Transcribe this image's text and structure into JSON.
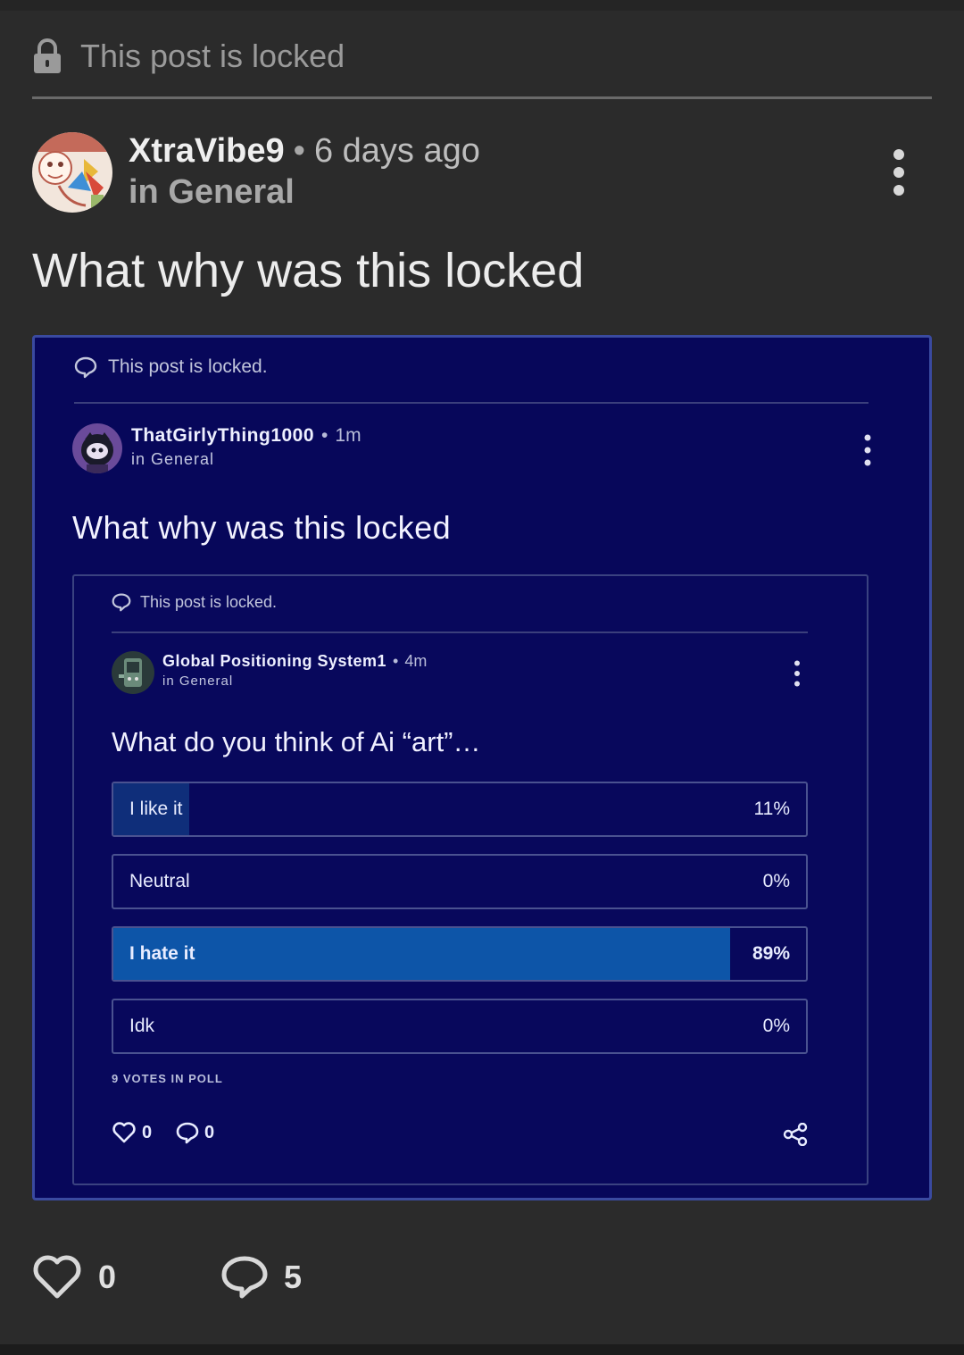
{
  "locked_notice": "This post is locked",
  "post": {
    "author": "XtraVibe9",
    "time": "6 days ago",
    "category": "in General",
    "title": "What why was this locked",
    "likes": "0",
    "comments": "5"
  },
  "embed": {
    "locked_notice": "This post is locked.",
    "author": "ThatGirlyThing1000",
    "time": "1m",
    "category": "in General",
    "title": "What why was this locked",
    "inner": {
      "locked_notice": "This post is locked.",
      "author": "Global Positioning System1",
      "time": "4m",
      "category": "in General",
      "title": "What do you think of Ai “art”…",
      "poll": {
        "options": [
          {
            "label": "I like it",
            "percent": 11,
            "percent_text": "11%"
          },
          {
            "label": "Neutral",
            "percent": 0,
            "percent_text": "0%"
          },
          {
            "label": "I hate it",
            "percent": 89,
            "percent_text": "89%"
          },
          {
            "label": "Idk",
            "percent": 0,
            "percent_text": "0%"
          }
        ],
        "votes_text": "9 VOTES IN POLL"
      },
      "likes": "0",
      "comments": "0"
    }
  },
  "colors": {
    "background": "#2b2b2b",
    "embed_background": "#07075a",
    "poll_winner": "#0d55a8",
    "poll_fill": "#0f2e7a"
  }
}
